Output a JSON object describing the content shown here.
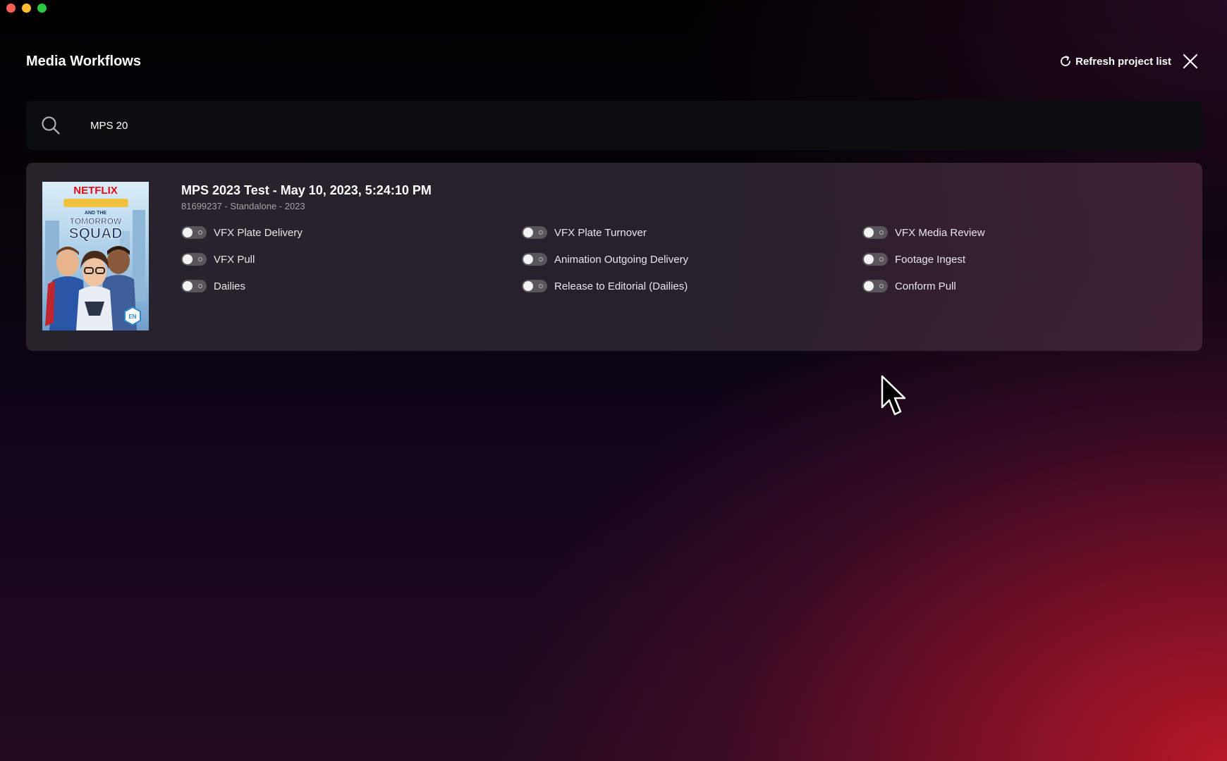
{
  "window": {
    "traffic_lights": [
      "close",
      "minimize",
      "zoom"
    ]
  },
  "header": {
    "title": "Media Workflows",
    "refresh_label": "Refresh project list",
    "refresh_icon": "refresh-icon",
    "close_icon": "close-icon"
  },
  "search": {
    "icon": "search-icon",
    "value": "MPS 20"
  },
  "project": {
    "title": "MPS 2023 Test - May 10, 2023, 5:24:10 PM",
    "subtitle": "81699237 - Standalone - 2023",
    "poster": {
      "brand": "NETFLIX",
      "line1": "AND THE",
      "line2": "TOMORROW",
      "line3": "SQUAD",
      "badge": "EN"
    },
    "workflows": [
      {
        "label": "VFX Plate Delivery",
        "enabled": false
      },
      {
        "label": "VFX Plate Turnover",
        "enabled": false
      },
      {
        "label": "VFX Media Review",
        "enabled": false
      },
      {
        "label": "VFX Pull",
        "enabled": false
      },
      {
        "label": "Animation Outgoing Delivery",
        "enabled": false
      },
      {
        "label": "Footage Ingest",
        "enabled": false
      },
      {
        "label": "Dailies",
        "enabled": false
      },
      {
        "label": "Release to Editorial (Dailies)",
        "enabled": false
      },
      {
        "label": "Conform Pull",
        "enabled": false
      }
    ]
  },
  "colors": {
    "accent_red": "#e50914",
    "card_background": "#2a2530",
    "search_background": "#0c0d0f",
    "toggle_off": "#58555b"
  }
}
